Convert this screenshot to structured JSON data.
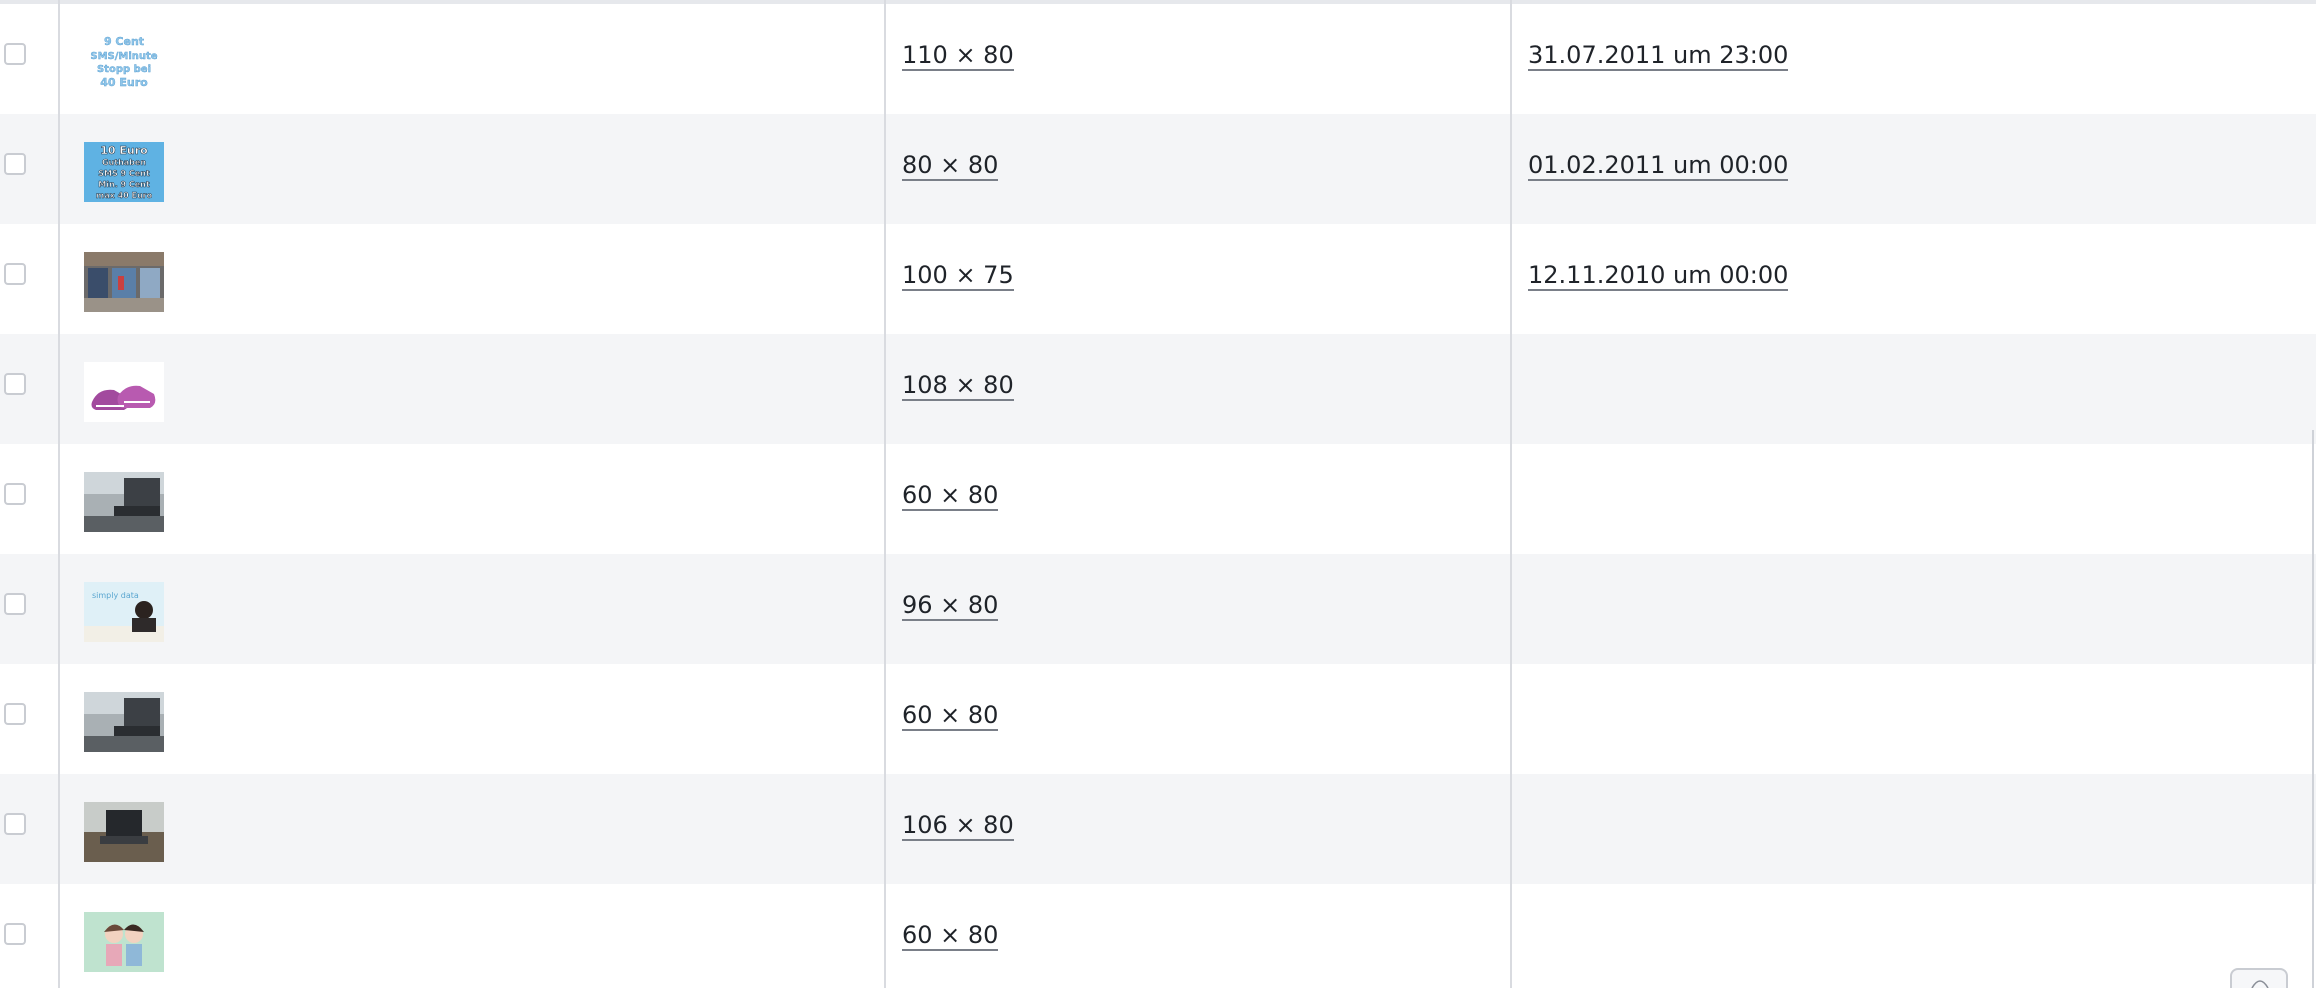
{
  "rows": [
    {
      "dimensions": "110 × 80",
      "date": "31.07.2011 um 23:00",
      "thumb": "sms-offer-thumb",
      "thumb_lines": [
        "9 Cent",
        "SMS/Minute",
        "Stopp bei",
        "40 Euro"
      ]
    },
    {
      "dimensions": "80 × 80",
      "date": "01.02.2011 um 00:00",
      "thumb": "credit-offer-thumb",
      "thumb_lines": [
        "10 Euro",
        "Guthaben",
        "SMS 9 Cent",
        "Min. 9 Cent",
        "max 40 Euro"
      ]
    },
    {
      "dimensions": "100 × 75",
      "date": "12.11.2010 um 00:00",
      "thumb": "storefront-thumb"
    },
    {
      "dimensions": "108 × 80",
      "date": "",
      "thumb": "sneakers-thumb"
    },
    {
      "dimensions": "60 × 80",
      "date": "",
      "thumb": "laptop-outdoor-thumb"
    },
    {
      "dimensions": "96 × 80",
      "date": "",
      "thumb": "person-ad-thumb",
      "thumb_lines": [
        "simply data"
      ]
    },
    {
      "dimensions": "60 × 80",
      "date": "",
      "thumb": "laptop-outdoor-thumb-2"
    },
    {
      "dimensions": "106 × 80",
      "date": "",
      "thumb": "laptop-field-thumb"
    },
    {
      "dimensions": "60 × 80",
      "date": "",
      "thumb": "couple-illustration-thumb"
    }
  ],
  "colors": {
    "row_alt": "#f4f5f7",
    "divider": "#d9dbe0",
    "text": "#1f2329"
  }
}
